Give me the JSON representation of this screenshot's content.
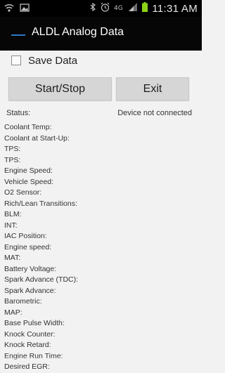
{
  "status_bar": {
    "time": "11:31 AM",
    "icons": [
      "wifi-icon",
      "image-icon",
      "bluetooth-icon",
      "alarm-icon",
      "data-4g-icon",
      "signal-icon",
      "battery-icon"
    ]
  },
  "app_bar": {
    "title": "ALDL Analog Data"
  },
  "save_data": {
    "label": "Save Data",
    "checked": false
  },
  "buttons": {
    "start_stop": "Start/Stop",
    "exit": "Exit"
  },
  "status": {
    "label": "Status:",
    "value": "Device not connected"
  },
  "data_fields": [
    "Coolant Temp:",
    "Coolant at Start-Up:",
    "TPS:",
    "TPS:",
    "Engine Speed:",
    "Vehicle Speed:",
    "O2 Sensor:",
    "Rich/Lean Transitions:",
    "BLM:",
    "INT:",
    "IAC Position:",
    "Engine speed:",
    "MAT:",
    "Battery Voltage:",
    "Spark Advance (TDC):",
    "Spark Advance:",
    "Barometric:",
    "MAP:",
    "Base Pulse Width:",
    "Knock Counter:",
    "Knock Retard:",
    "Engine Run Time:",
    "Desired EGR:"
  ],
  "colors": {
    "accent": "#2b79c5",
    "battery": "#8cd316",
    "background": "#f2f2f2"
  }
}
